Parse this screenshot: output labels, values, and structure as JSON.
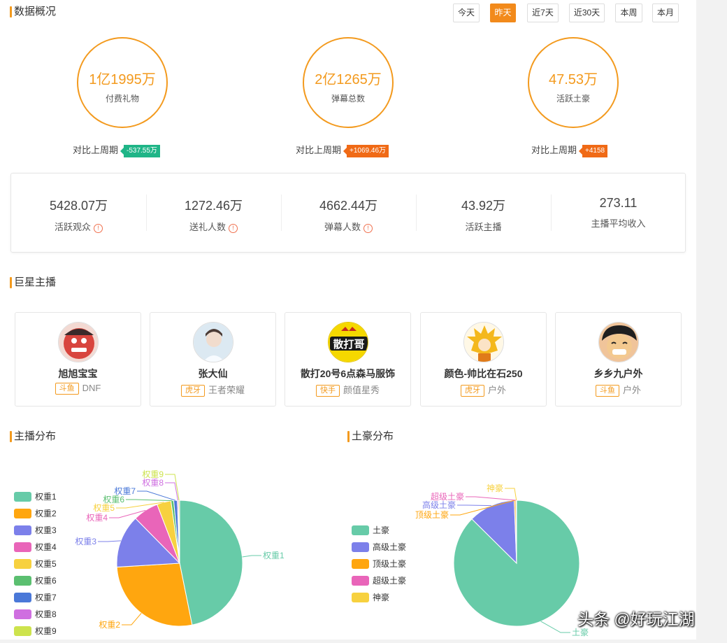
{
  "overview": {
    "title": "数据概况",
    "tabs": [
      "今天",
      "昨天",
      "近7天",
      "近30天",
      "本周",
      "本月"
    ],
    "active_tab": "昨天",
    "circles": [
      {
        "value": "1亿1995万",
        "label": "付费礼物",
        "compare_label": "对比上周期",
        "delta": "-537.55万",
        "delta_color": "green"
      },
      {
        "value": "2亿1265万",
        "label": "弹幕总数",
        "compare_label": "对比上周期",
        "delta": "+1069.46万",
        "delta_color": "orange"
      },
      {
        "value": "47.53万",
        "label": "活跃土豪",
        "compare_label": "对比上周期",
        "delta": "+4158",
        "delta_color": "orange"
      }
    ],
    "stats": [
      {
        "value": "5428.07万",
        "label": "活跃观众",
        "info": true
      },
      {
        "value": "1272.46万",
        "label": "送礼人数",
        "info": true
      },
      {
        "value": "4662.44万",
        "label": "弹幕人数",
        "info": true
      },
      {
        "value": "43.92万",
        "label": "活跃主播",
        "info": false
      },
      {
        "value": "273.11",
        "label": "主播平均收入",
        "info": false
      }
    ]
  },
  "stars": {
    "title": "巨星主播",
    "items": [
      {
        "name": "旭旭宝宝",
        "platform": "斗鱼",
        "category": "DNF"
      },
      {
        "name": "张大仙",
        "platform": "虎牙",
        "category": "王者荣耀"
      },
      {
        "name": "散打20号6点森马服饰",
        "platform": "快手",
        "category": "颜值星秀",
        "avatar_text": "散打哥"
      },
      {
        "name": "颜色-帅比在石250",
        "platform": "虎牙",
        "category": "户外"
      },
      {
        "name": "乡乡九户外",
        "platform": "斗鱼",
        "category": "户外"
      }
    ]
  },
  "streamer_dist": {
    "title": "主播分布"
  },
  "tycoon_dist": {
    "title": "土豪分布"
  },
  "chart_data": [
    {
      "type": "pie",
      "title": "主播分布",
      "categories": [
        "权重1",
        "权重2",
        "权重3",
        "权重4",
        "权重5",
        "权重6",
        "权重7",
        "权重8",
        "权重9"
      ],
      "values": [
        46.5,
        27.0,
        13.5,
        6.5,
        3.6,
        0.7,
        0.9,
        0.3,
        0.3
      ],
      "colors": [
        "#67cba8",
        "#ffa60f",
        "#7c80ea",
        "#e965b9",
        "#f7d13f",
        "#5bbf70",
        "#4a78d8",
        "#cf6fe0",
        "#cde34d"
      ],
      "legend_position": "left"
    },
    {
      "type": "pie",
      "title": "土豪分布",
      "categories": [
        "土豪",
        "高级土豪",
        "顶级土豪",
        "超级土豪",
        "神豪"
      ],
      "values": [
        87.4,
        12.0,
        0.4,
        0.1,
        0.1
      ],
      "colors": [
        "#67cba8",
        "#7c80ea",
        "#ffa60f",
        "#e965b9",
        "#f7d13f"
      ],
      "legend_position": "left"
    }
  ],
  "watermark": "头条 @好玩江湖"
}
